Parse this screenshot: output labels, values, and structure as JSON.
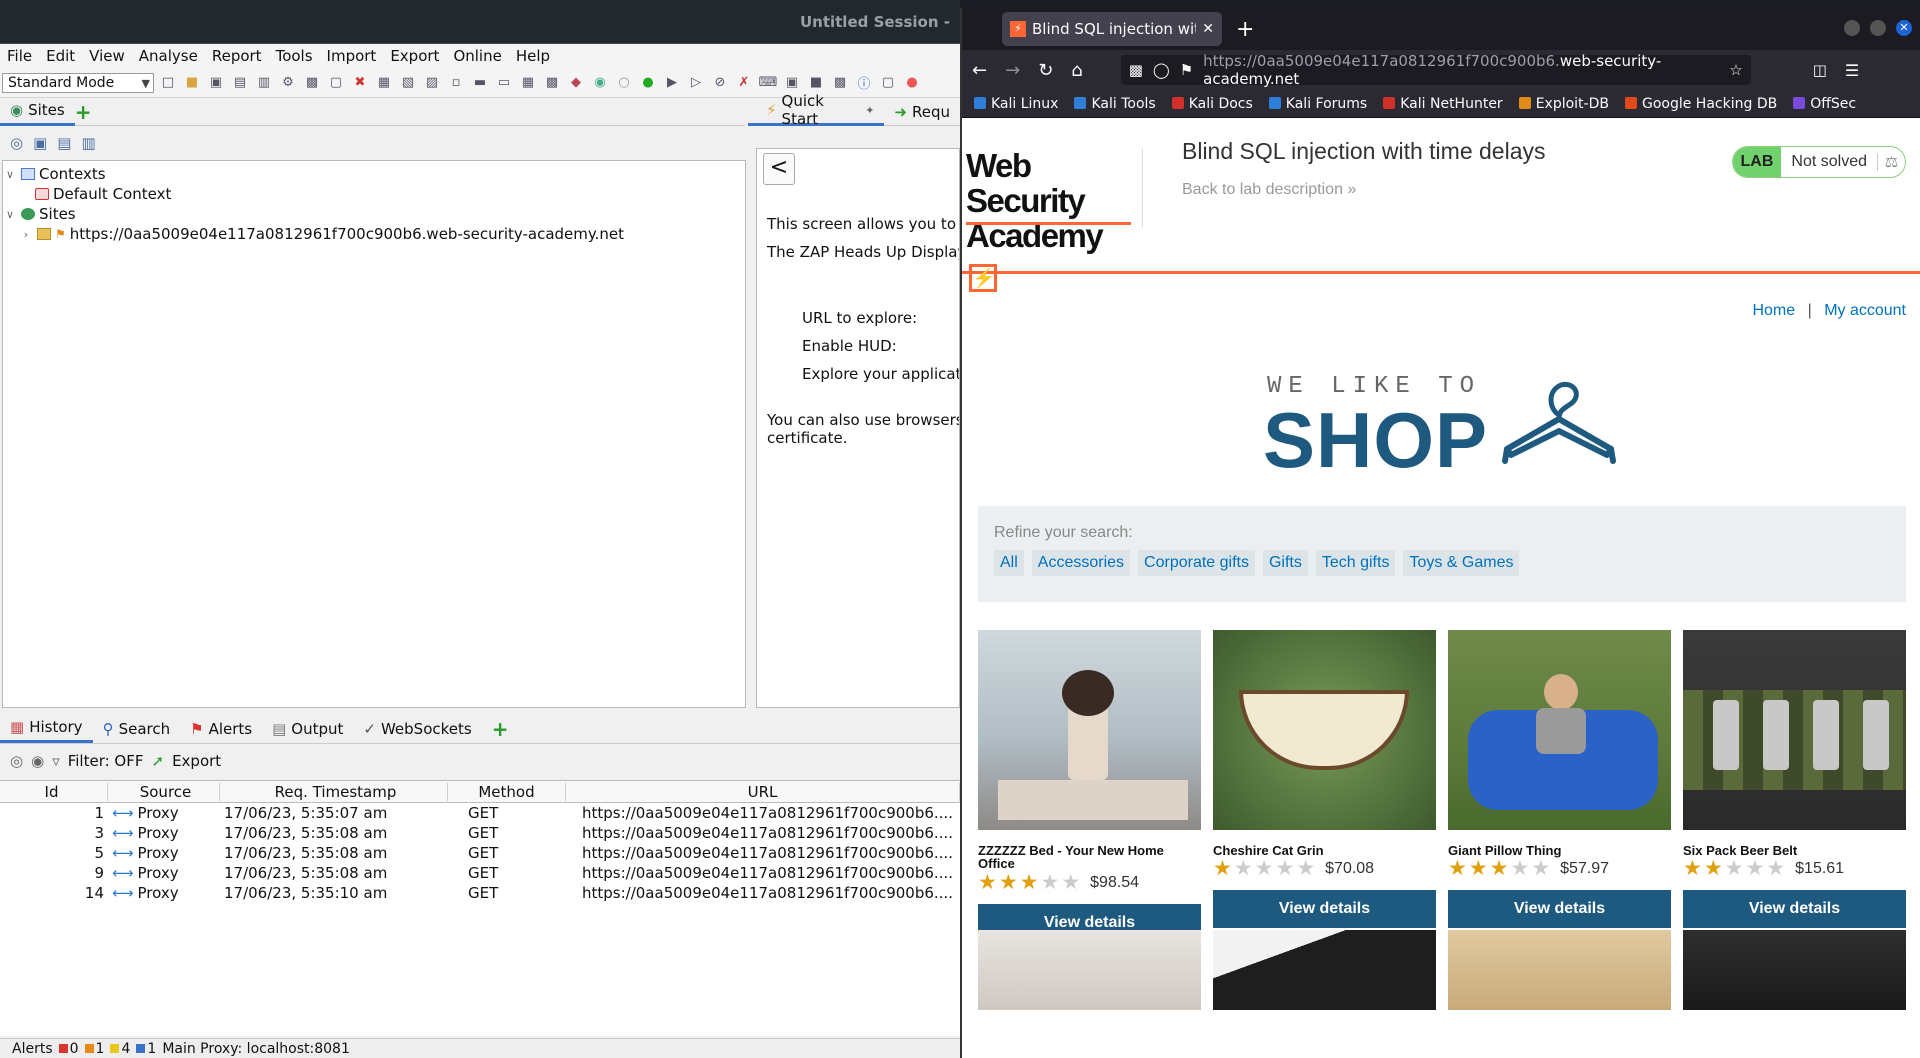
{
  "zap": {
    "title": "Untitled Session -",
    "menu": [
      "File",
      "Edit",
      "View",
      "Analyse",
      "Report",
      "Tools",
      "Import",
      "Export",
      "Online",
      "Help"
    ],
    "mode": "Standard Mode",
    "sites_tab": "Sites",
    "quickstart_tab": "Quick Start",
    "request_tab": "Requ",
    "tree": {
      "contexts": "Contexts",
      "default_context": "Default Context",
      "sites": "Sites",
      "site_url": "https://0aa5009e04e117a0812961f700c900b6.web-security-academy.net"
    },
    "quickstart": {
      "back": "<",
      "line1": "This screen allows you to l",
      "line2": "The ZAP Heads Up Display",
      "url_label": "URL to explore:",
      "hud_label": "Enable HUD:",
      "explore_label": "Explore your applicati",
      "line3": "You can also use browsers",
      "line4": "certificate."
    },
    "bottom_tabs": [
      "History",
      "Search",
      "Alerts",
      "Output",
      "WebSockets"
    ],
    "filter": "Filter: OFF",
    "export": "Export",
    "history_headers": [
      "Id",
      "Source",
      "Req. Timestamp",
      "Method",
      "URL"
    ],
    "history_rows": [
      {
        "id": "1",
        "source": "Proxy",
        "ts": "17/06/23, 5:35:07 am",
        "method": "GET",
        "url": "https://0aa5009e04e117a0812961f700c900b6...."
      },
      {
        "id": "3",
        "source": "Proxy",
        "ts": "17/06/23, 5:35:08 am",
        "method": "GET",
        "url": "https://0aa5009e04e117a0812961f700c900b6...."
      },
      {
        "id": "5",
        "source": "Proxy",
        "ts": "17/06/23, 5:35:08 am",
        "method": "GET",
        "url": "https://0aa5009e04e117a0812961f700c900b6...."
      },
      {
        "id": "9",
        "source": "Proxy",
        "ts": "17/06/23, 5:35:08 am",
        "method": "GET",
        "url": "https://0aa5009e04e117a0812961f700c900b6...."
      },
      {
        "id": "14",
        "source": "Proxy",
        "ts": "17/06/23, 5:35:10 am",
        "method": "GET",
        "url": "https://0aa5009e04e117a0812961f700c900b6...."
      }
    ],
    "status": {
      "alerts": "Alerts",
      "red": "0",
      "orange": "1",
      "yellow": "4",
      "blue": "1",
      "proxy": "Main Proxy: localhost:8081"
    }
  },
  "firefox": {
    "tab_title": "Blind SQL injection with ti",
    "url_prefix": "https://0aa5009e04e117a0812961f700c900b6.",
    "url_domain": "web-security-academy.net",
    "bookmarks": [
      {
        "label": "Kali Linux",
        "color": "#2d7fd8"
      },
      {
        "label": "Kali Tools",
        "color": "#2d7fd8"
      },
      {
        "label": "Kali Docs",
        "color": "#d0302a"
      },
      {
        "label": "Kali Forums",
        "color": "#2d7fd8"
      },
      {
        "label": "Kali NetHunter",
        "color": "#d0302a"
      },
      {
        "label": "Exploit-DB",
        "color": "#e08a1a"
      },
      {
        "label": "Google Hacking DB",
        "color": "#e04a1a"
      },
      {
        "label": "OffSec",
        "color": "#7a4ad8"
      }
    ]
  },
  "page": {
    "logo_line1": "Web Security",
    "logo_line2": "Academy",
    "lab_title": "Blind SQL injection with time delays",
    "back_link": "Back to lab description",
    "lab_badge": "LAB",
    "lab_status": "Not solved",
    "nav_home": "Home",
    "nav_sep": "|",
    "nav_account": "My account",
    "shop_we": "WE LIKE TO",
    "shop_shop": "SHOP",
    "refine_label": "Refine your search:",
    "filters": [
      "All",
      "Accessories",
      "Corporate gifts",
      "Gifts",
      "Tech gifts",
      "Toys & Games"
    ],
    "view_details": "View details",
    "products": [
      {
        "name": "ZZZZZZ Bed - Your New Home Office",
        "price": "$98.54",
        "stars": 3
      },
      {
        "name": "Cheshire Cat Grin",
        "price": "$70.08",
        "stars": 1
      },
      {
        "name": "Giant Pillow Thing",
        "price": "$57.97",
        "stars": 3
      },
      {
        "name": "Six Pack Beer Belt",
        "price": "$15.61",
        "stars": 2
      }
    ],
    "accent": "#ff6633",
    "button_color": "#1e5a80"
  }
}
